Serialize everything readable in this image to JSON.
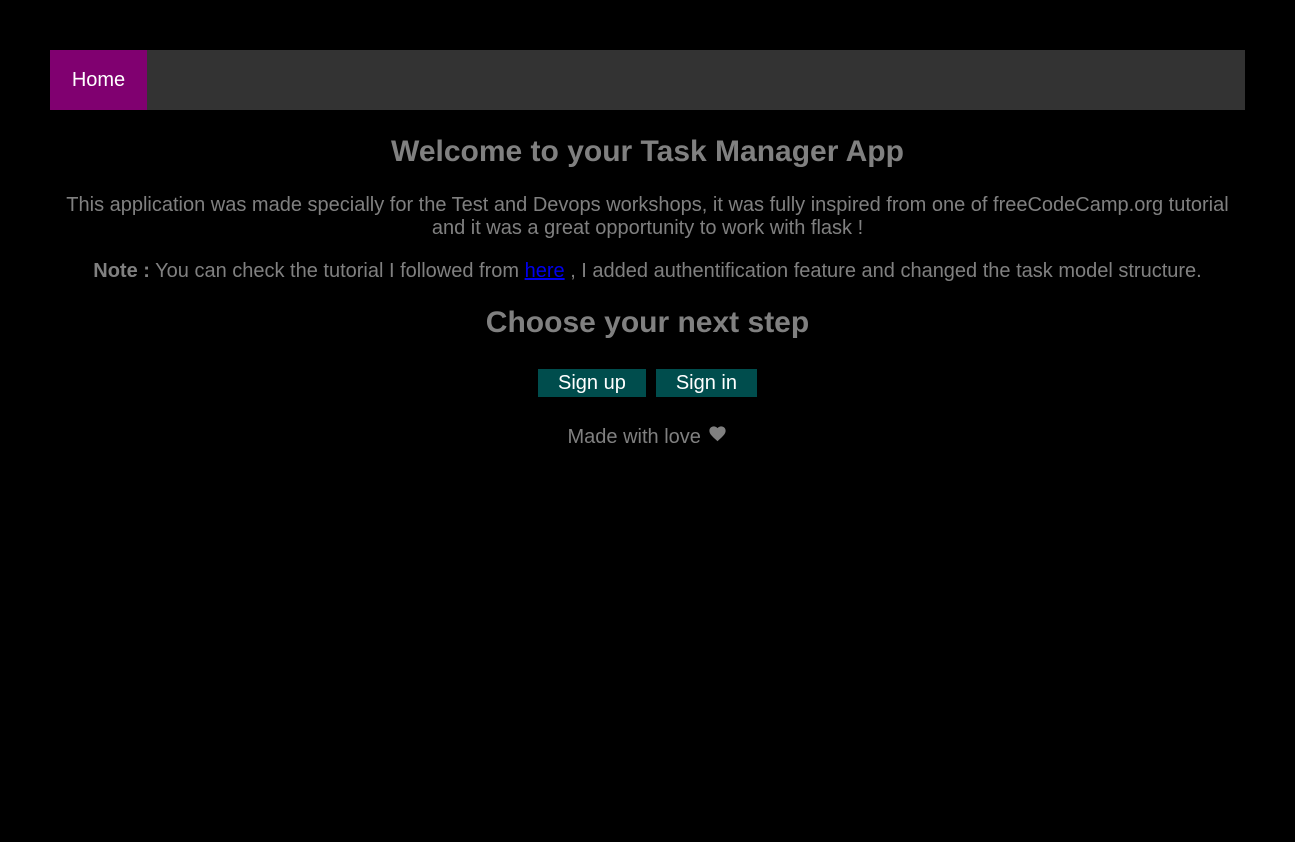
{
  "nav": {
    "home_label": "Home",
    "home_color": "#800070",
    "bar_color": "#333333"
  },
  "main": {
    "title": "Welcome to your Task Manager App",
    "description": "This application was made specially for the Test and Devops workshops, it was fully inspired from one of freeCodeCamp.org tutorial and it was a great opportunity to work with flask !",
    "note_label": "Note :",
    "note_before_link": " You can check the tutorial I followed from ",
    "note_link_text": "here",
    "note_after_link": " , I added authentification feature and changed the task model structure.",
    "subtitle": "Choose your next step",
    "buttons": {
      "signup_label": "Sign up",
      "signin_label": "Sign in",
      "button_color": "#004d4d"
    }
  },
  "footer": {
    "text": "Made with love",
    "icon": "heart-icon"
  }
}
